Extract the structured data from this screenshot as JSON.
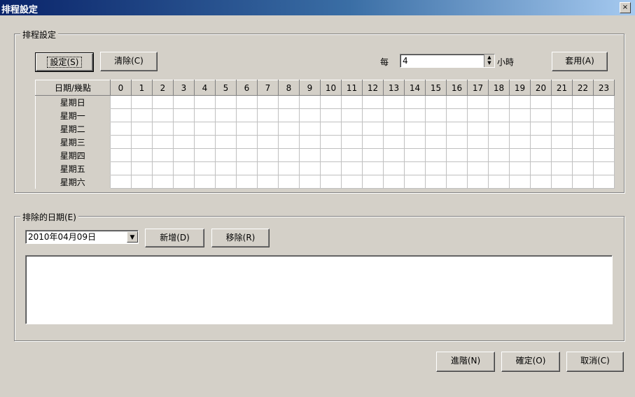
{
  "window": {
    "title": "排程設定",
    "close_symbol": "×"
  },
  "schedule_group": {
    "legend": "排程設定",
    "set_button": "設定(S)",
    "clear_button": "清除(C)",
    "every_label": "每",
    "every_value": "4",
    "hours_label": "小時",
    "apply_button": "套用(A)",
    "table": {
      "corner_header": "日期/幾點",
      "hours": [
        "0",
        "1",
        "2",
        "3",
        "4",
        "5",
        "6",
        "7",
        "8",
        "9",
        "10",
        "11",
        "12",
        "13",
        "14",
        "15",
        "16",
        "17",
        "18",
        "19",
        "20",
        "21",
        "22",
        "23"
      ],
      "days": [
        "星期日",
        "星期一",
        "星期二",
        "星期三",
        "星期四",
        "星期五",
        "星期六"
      ]
    }
  },
  "exclude_group": {
    "legend": "排除的日期(E)",
    "date_value": "2010年04月09日",
    "add_button": "新增(D)",
    "remove_button": "移除(R)"
  },
  "footer": {
    "advanced_button": "進階(N)",
    "ok_button": "確定(O)",
    "cancel_button": "取消(C)"
  }
}
